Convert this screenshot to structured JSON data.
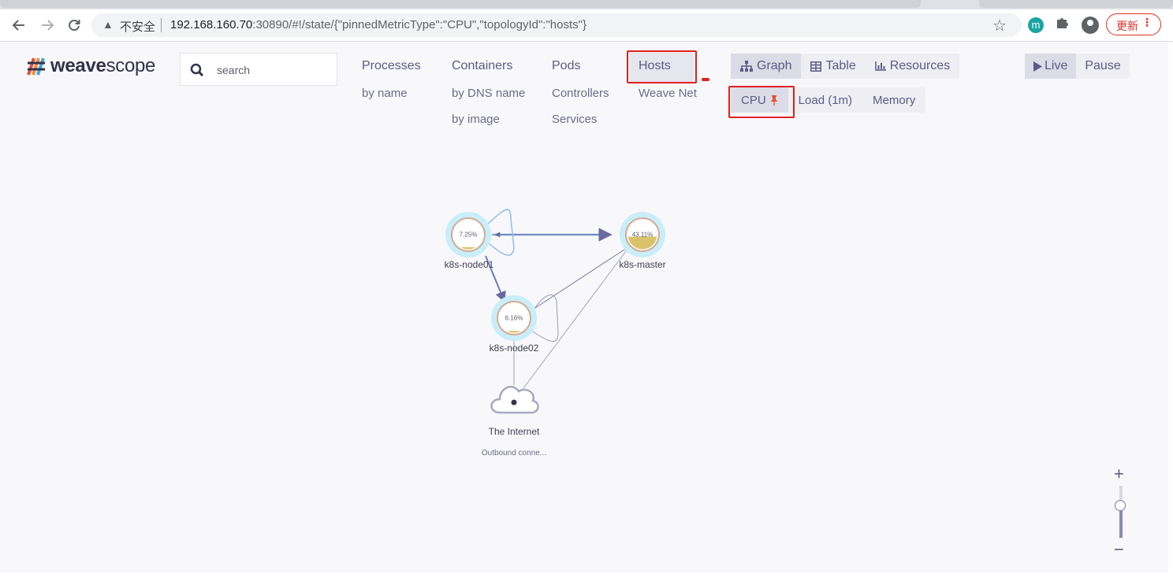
{
  "browser": {
    "address_insecure_label": "不安全",
    "url_host": "192.168.160.70",
    "url_rest": ":30890/#!/state/{\"pinnedMetricType\":\"CPU\",\"topologyId\":\"hosts\"}",
    "extension_letter": "m",
    "update_label": "更新"
  },
  "app": {
    "logo_bold": "weave",
    "logo_light": "scope",
    "search_placeholder": "search",
    "topologies": [
      {
        "label": "Processes",
        "subs": [
          "by name"
        ]
      },
      {
        "label": "Containers",
        "subs": [
          "by DNS name",
          "by image"
        ]
      },
      {
        "label": "Pods",
        "subs": [
          "Controllers",
          "Services"
        ]
      },
      {
        "label": "Hosts",
        "subs": [
          "Weave Net"
        ],
        "selected": true
      }
    ],
    "view_modes": [
      {
        "label": "Graph",
        "icon": "sitemap-icon",
        "active": true
      },
      {
        "label": "Table",
        "icon": "table-icon",
        "active": false
      },
      {
        "label": "Resources",
        "icon": "bar-chart-icon",
        "active": false
      }
    ],
    "metrics": [
      {
        "label": "CPU",
        "active": true,
        "pinned": true
      },
      {
        "label": "Load (1m)",
        "active": false
      },
      {
        "label": "Memory",
        "active": false
      }
    ],
    "time_control": [
      {
        "label": "Live",
        "icon": "play-icon",
        "active": true
      },
      {
        "label": "Pause",
        "active": false
      }
    ],
    "nodes": [
      {
        "id": "k8s-node01",
        "label": "k8s-node01",
        "metric_label": "7.25%",
        "metric": 0.0725
      },
      {
        "id": "k8s-master",
        "label": "k8s-master",
        "metric_label": "43.11%",
        "metric": 0.4311
      },
      {
        "id": "k8s-node02",
        "label": "k8s-node02",
        "metric_label": "6.16%",
        "metric": 0.0616
      },
      {
        "id": "internet",
        "label": "The Internet",
        "sublabel": "Outbound conne..."
      }
    ],
    "zoom": {
      "plus": "+",
      "minus": "−",
      "level": 0.62
    },
    "colors": {
      "accent": "#5b5b88",
      "highlight_red": "#e0201d",
      "node_ring": "#c8eefa",
      "metric_fill": "#d9c36a"
    }
  }
}
